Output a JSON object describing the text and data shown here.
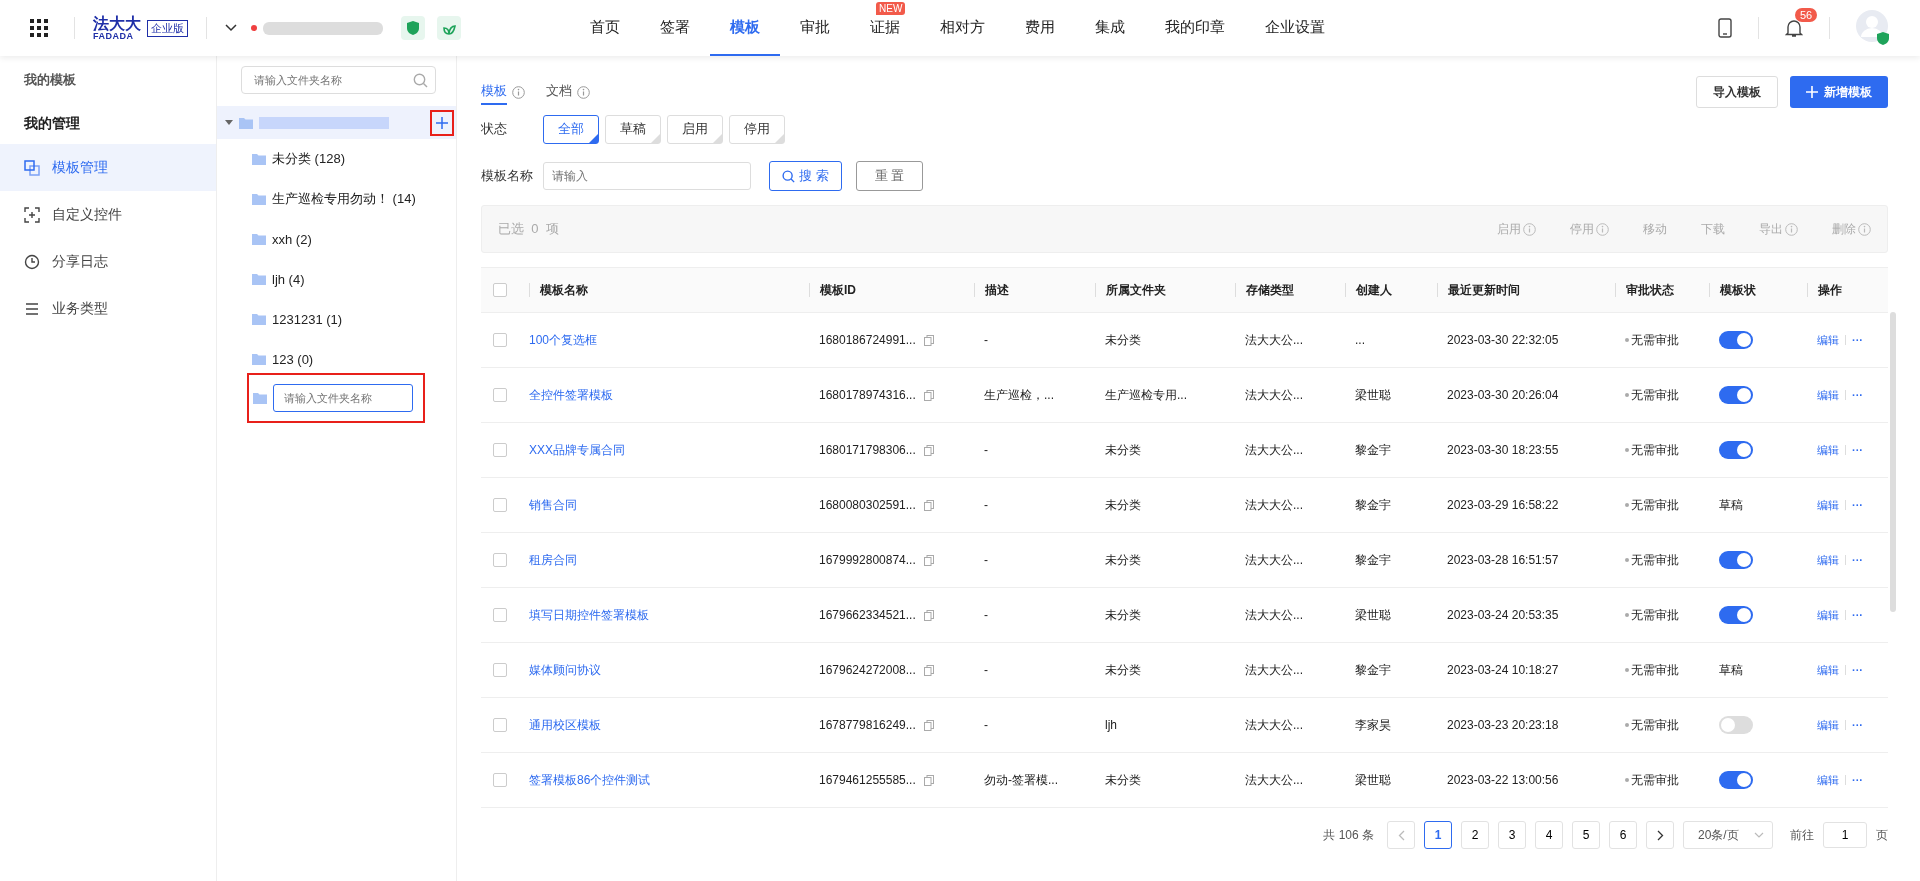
{
  "top_nav": {
    "brand": {
      "logo_cn": "法大大",
      "logo_en": "FADADA",
      "edition": "企业版"
    },
    "menu": [
      {
        "label": "首页",
        "selected": false
      },
      {
        "label": "签署",
        "selected": false
      },
      {
        "label": "模板",
        "selected": true
      },
      {
        "label": "审批",
        "selected": false
      },
      {
        "label": "证据",
        "selected": false,
        "badge": "NEW"
      },
      {
        "label": "相对方",
        "selected": false
      },
      {
        "label": "费用",
        "selected": false
      },
      {
        "label": "集成",
        "selected": false
      },
      {
        "label": "我的印章",
        "selected": false
      },
      {
        "label": "企业设置",
        "selected": false
      }
    ],
    "notification_badge": "56"
  },
  "sidebar": {
    "section_title": "我的模板",
    "group_title": "我的管理",
    "items": [
      {
        "label": "模板管理",
        "selected": true
      },
      {
        "label": "自定义控件",
        "selected": false
      },
      {
        "label": "分享日志",
        "selected": false
      },
      {
        "label": "业务类型",
        "selected": false
      }
    ]
  },
  "folder_tree": {
    "search_placeholder": "请输入文件夹名称",
    "root": {
      "expanded": true,
      "children": [
        {
          "label": "未分类 (128)"
        },
        {
          "label": "生产巡检专用勿动！ (14)"
        },
        {
          "label": "xxh (2)"
        },
        {
          "label": "ljh (4)"
        },
        {
          "label": "1231231 (1)"
        },
        {
          "label": "123 (0)"
        }
      ]
    },
    "new_folder_placeholder": "请输入文件夹名称"
  },
  "main": {
    "tabs": [
      {
        "label": "模板",
        "selected": true
      },
      {
        "label": "文档",
        "selected": false
      }
    ],
    "import_button": "导入模板",
    "add_button": "新增模板",
    "status_filter": {
      "label": "状态",
      "options": [
        {
          "label": "全部",
          "selected": true
        },
        {
          "label": "草稿",
          "selected": false
        },
        {
          "label": "启用",
          "selected": false
        },
        {
          "label": "停用",
          "selected": false
        }
      ]
    },
    "name_filter": {
      "label": "模板名称",
      "placeholder": "请输入"
    },
    "search_button": "搜 索",
    "reset_button": "重 置",
    "selection_bar": {
      "prefix": "已选",
      "count": "0",
      "suffix": "项",
      "actions": [
        {
          "label": "启用",
          "info": true
        },
        {
          "label": "停用",
          "info": true
        },
        {
          "label": "移动",
          "info": false
        },
        {
          "label": "下载",
          "info": false
        },
        {
          "label": "导出",
          "info": true
        },
        {
          "label": "删除",
          "info": true
        }
      ]
    },
    "table": {
      "select_all_checked": false,
      "columns": [
        "模板名称",
        "模板ID",
        "描述",
        "所属文件夹",
        "存储类型",
        "创建人",
        "最近更新时间",
        "审批状态",
        "模板状",
        "操作"
      ],
      "rows": [
        {
          "checked": false,
          "name": "100个复选框",
          "id": "1680186724991...",
          "description": "-",
          "folder": "未分类",
          "storage": "法大大公...",
          "creator": "...",
          "updated": "2023-03-30 22:32:05",
          "approval": "无需审批",
          "status": {
            "kind": "toggle",
            "on": true
          },
          "actions": {
            "edit": "编辑",
            "more": "···"
          }
        },
        {
          "checked": false,
          "name": "全控件签署模板",
          "id": "1680178974316...",
          "description": "生产巡检，...",
          "folder": "生产巡检专用...",
          "storage": "法大大公...",
          "creator": "梁世聪",
          "updated": "2023-03-30 20:26:04",
          "approval": "无需审批",
          "status": {
            "kind": "toggle",
            "on": true
          },
          "actions": {
            "edit": "编辑",
            "more": "···"
          }
        },
        {
          "checked": false,
          "name": "XXX品牌专属合同",
          "id": "1680171798306...",
          "description": "-",
          "folder": "未分类",
          "storage": "法大大公...",
          "creator": "黎金宇",
          "updated": "2023-03-30 18:23:55",
          "approval": "无需审批",
          "status": {
            "kind": "toggle",
            "on": true
          },
          "actions": {
            "edit": "编辑",
            "more": "···"
          }
        },
        {
          "checked": false,
          "name": "销售合同",
          "id": "1680080302591...",
          "description": "-",
          "folder": "未分类",
          "storage": "法大大公...",
          "creator": "黎金宇",
          "updated": "2023-03-29 16:58:22",
          "approval": "无需审批",
          "status": {
            "kind": "text",
            "text": "草稿"
          },
          "actions": {
            "edit": "编辑",
            "more": "···"
          }
        },
        {
          "checked": false,
          "name": "租房合同",
          "id": "1679992800874...",
          "description": "-",
          "folder": "未分类",
          "storage": "法大大公...",
          "creator": "黎金宇",
          "updated": "2023-03-28 16:51:57",
          "approval": "无需审批",
          "status": {
            "kind": "toggle",
            "on": true
          },
          "actions": {
            "edit": "编辑",
            "more": "···"
          }
        },
        {
          "checked": false,
          "name": "填写日期控件签署模板",
          "id": "1679662334521...",
          "description": "-",
          "folder": "未分类",
          "storage": "法大大公...",
          "creator": "梁世聪",
          "updated": "2023-03-24 20:53:35",
          "approval": "无需审批",
          "status": {
            "kind": "toggle",
            "on": true
          },
          "actions": {
            "edit": "编辑",
            "more": "···"
          }
        },
        {
          "checked": false,
          "name": "媒体顾问协议",
          "id": "1679624272008...",
          "description": "-",
          "folder": "未分类",
          "storage": "法大大公...",
          "creator": "黎金宇",
          "updated": "2023-03-24 10:18:27",
          "approval": "无需审批",
          "status": {
            "kind": "text",
            "text": "草稿"
          },
          "actions": {
            "edit": "编辑",
            "more": "···"
          }
        },
        {
          "checked": false,
          "name": "通用校区模板",
          "id": "1678779816249...",
          "description": "-",
          "folder": "ljh",
          "storage": "法大大公...",
          "creator": "李家昊",
          "updated": "2023-03-23 20:23:18",
          "approval": "无需审批",
          "status": {
            "kind": "toggle",
            "on": false
          },
          "actions": {
            "edit": "编辑",
            "more": "···"
          }
        },
        {
          "checked": false,
          "name": "签署模板86个控件测试",
          "id": "1679461255585...",
          "description": "勿动-签署模...",
          "folder": "未分类",
          "storage": "法大大公...",
          "creator": "梁世聪",
          "updated": "2023-03-22 13:00:56",
          "approval": "无需审批",
          "status": {
            "kind": "toggle",
            "on": true
          },
          "actions": {
            "edit": "编辑",
            "more": "···"
          }
        }
      ]
    },
    "pagination": {
      "total": "共 106 条",
      "pages": [
        {
          "label": "1",
          "selected": true
        },
        {
          "label": "2",
          "selected": false
        },
        {
          "label": "3",
          "selected": false
        },
        {
          "label": "4",
          "selected": false
        },
        {
          "label": "5",
          "selected": false
        },
        {
          "label": "6",
          "selected": false
        }
      ],
      "page_size": "20条/页",
      "goto_label": "前往",
      "goto_value": "1",
      "goto_suffix": "页"
    }
  }
}
